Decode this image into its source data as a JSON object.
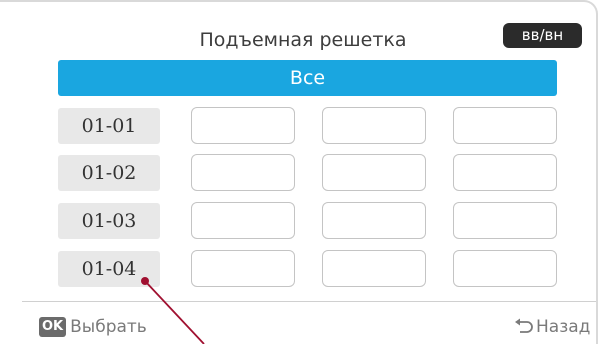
{
  "header": {
    "title": "Подъемная решетка",
    "mode_badge": "вв/вн"
  },
  "select_all": {
    "label": "Все"
  },
  "rows": [
    {
      "label": "01-01",
      "cells": [
        "",
        "",
        ""
      ]
    },
    {
      "label": "01-02",
      "cells": [
        "",
        "",
        ""
      ]
    },
    {
      "label": "01-03",
      "cells": [
        "",
        "",
        ""
      ]
    },
    {
      "label": "01-04",
      "cells": [
        "",
        "",
        ""
      ]
    }
  ],
  "footer": {
    "ok_key": "OK",
    "ok_label": "Выбрать",
    "back_label": "Назад"
  },
  "colors": {
    "accent": "#1aa6e0",
    "badge": "#2b2b2b",
    "pointer_line": "#a01030"
  },
  "icons": {
    "back": "back-arrow-icon",
    "pointer": "callout-pointer-icon"
  }
}
